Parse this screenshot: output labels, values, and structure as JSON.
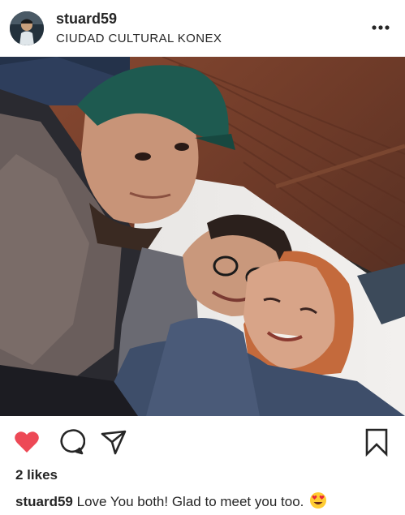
{
  "post": {
    "username": "stuard59",
    "location": "CIUDAD CULTURAL KONEX",
    "likes": "2 likes",
    "caption_username": "stuard59",
    "caption_text": "Love You both! Glad to meet you too.",
    "caption_emoji": "heart-eyes-emoji"
  },
  "icons": {
    "more": "more-options-icon",
    "like": "heart-icon",
    "comment": "comment-icon",
    "share": "share-icon",
    "save": "bookmark-icon"
  },
  "colors": {
    "like_active": "#ed4956",
    "text": "#262626",
    "background": "#ffffff"
  }
}
